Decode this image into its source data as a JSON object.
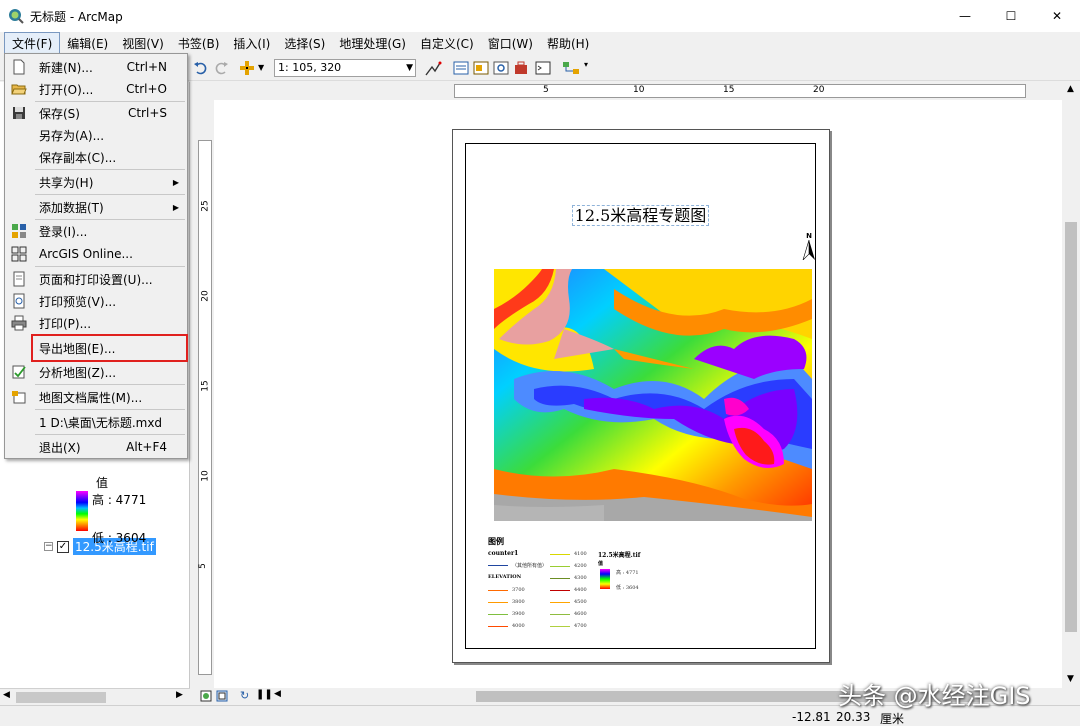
{
  "window": {
    "title": "无标题 - ArcMap",
    "minimize": "—",
    "maximize": "☐",
    "close": "✕"
  },
  "menubar": [
    "文件(F)",
    "编辑(E)",
    "视图(V)",
    "书签(B)",
    "插入(I)",
    "选择(S)",
    "地理处理(G)",
    "自定义(C)",
    "窗口(W)",
    "帮助(H)"
  ],
  "toolbar": {
    "scale": "1: 105, 320"
  },
  "file_menu": {
    "items": [
      {
        "label": "新建(N)...",
        "shortcut": "Ctrl+N"
      },
      {
        "label": "打开(O)...",
        "shortcut": "Ctrl+O"
      },
      {
        "label": "保存(S)",
        "shortcut": "Ctrl+S"
      },
      {
        "label": "另存为(A)..."
      },
      {
        "label": "保存副本(C)..."
      },
      {
        "label": "共享为(H)"
      },
      {
        "label": "添加数据(T)"
      },
      {
        "label": "登录(I)..."
      },
      {
        "label": "ArcGIS Online..."
      },
      {
        "label": "页面和打印设置(U)..."
      },
      {
        "label": "打印预览(V)..."
      },
      {
        "label": "打印(P)..."
      },
      {
        "label": "导出地图(E)..."
      },
      {
        "label": "分析地图(Z)..."
      },
      {
        "label": "地图文档属性(M)..."
      },
      {
        "label": "1 D:\\桌面\\无标题.mxd"
      },
      {
        "label": "退出(X)",
        "shortcut": "Alt+F4"
      }
    ]
  },
  "toc": {
    "layer_name": "12.5米高程.tif",
    "legend_header": "值",
    "high": "高 : 4771",
    "low": "低 : 3604"
  },
  "ruler": {
    "h_ticks": [
      "5",
      "10",
      "15",
      "20"
    ],
    "v_ticks": [
      "25",
      "20",
      "15",
      "10",
      "5"
    ]
  },
  "layout": {
    "title": "12.5米高程专题图",
    "north": "N",
    "legend": {
      "title": "图例",
      "contour_layer": "counter1",
      "contour_value": "〈其他所有值〉",
      "elevation_header": "ELEVATION",
      "col1": [
        "3700",
        "3800",
        "3900",
        "4000"
      ],
      "col2": [
        "4100",
        "4200",
        "4300",
        "4400",
        "4500",
        "4600",
        "4700"
      ],
      "raster_name": "12.5米高程.tif",
      "raster_value": "值",
      "raster_high": "高 : 4771",
      "raster_low": "低 : 3604"
    }
  },
  "status": {
    "x": "-12.81",
    "y": "20.33",
    "unit": "厘米"
  },
  "watermark": "头条 @水经注GIS"
}
